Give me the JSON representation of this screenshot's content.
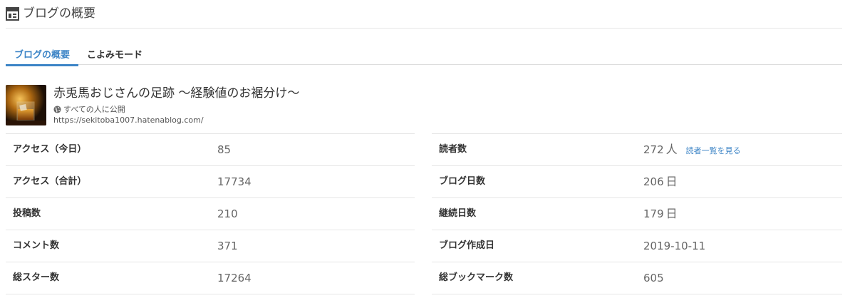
{
  "header": {
    "title": "ブログの概要",
    "icon": "dashboard-icon"
  },
  "tabs": [
    {
      "label": "ブログの概要",
      "active": true
    },
    {
      "label": "こよみモード",
      "active": false
    }
  ],
  "blog": {
    "name": "赤兎馬おじさんの足跡 ～経験値のお裾分け～",
    "visibility": "すべての人に公開",
    "url": "https://sekitoba1007.hatenablog.com/"
  },
  "stats_left": [
    {
      "label": "アクセス（今日）",
      "value": "85"
    },
    {
      "label": "アクセス（合計）",
      "value": "17734"
    },
    {
      "label": "投稿数",
      "value": "210"
    },
    {
      "label": "コメント数",
      "value": "371"
    },
    {
      "label": "総スター数",
      "value": "17264"
    }
  ],
  "stats_right": [
    {
      "label": "読者数",
      "value": "272",
      "unit": "人",
      "link": "読者一覧を見る"
    },
    {
      "label": "ブログ日数",
      "value": "206",
      "unit": "日"
    },
    {
      "label": "継続日数",
      "value": "179",
      "unit": "日"
    },
    {
      "label": "ブログ作成日",
      "value": "2019-10-11"
    },
    {
      "label": "総ブックマーク数",
      "value": "605"
    }
  ],
  "colors": {
    "accent": "#3c84c6",
    "divider": "#e6e6e6"
  }
}
